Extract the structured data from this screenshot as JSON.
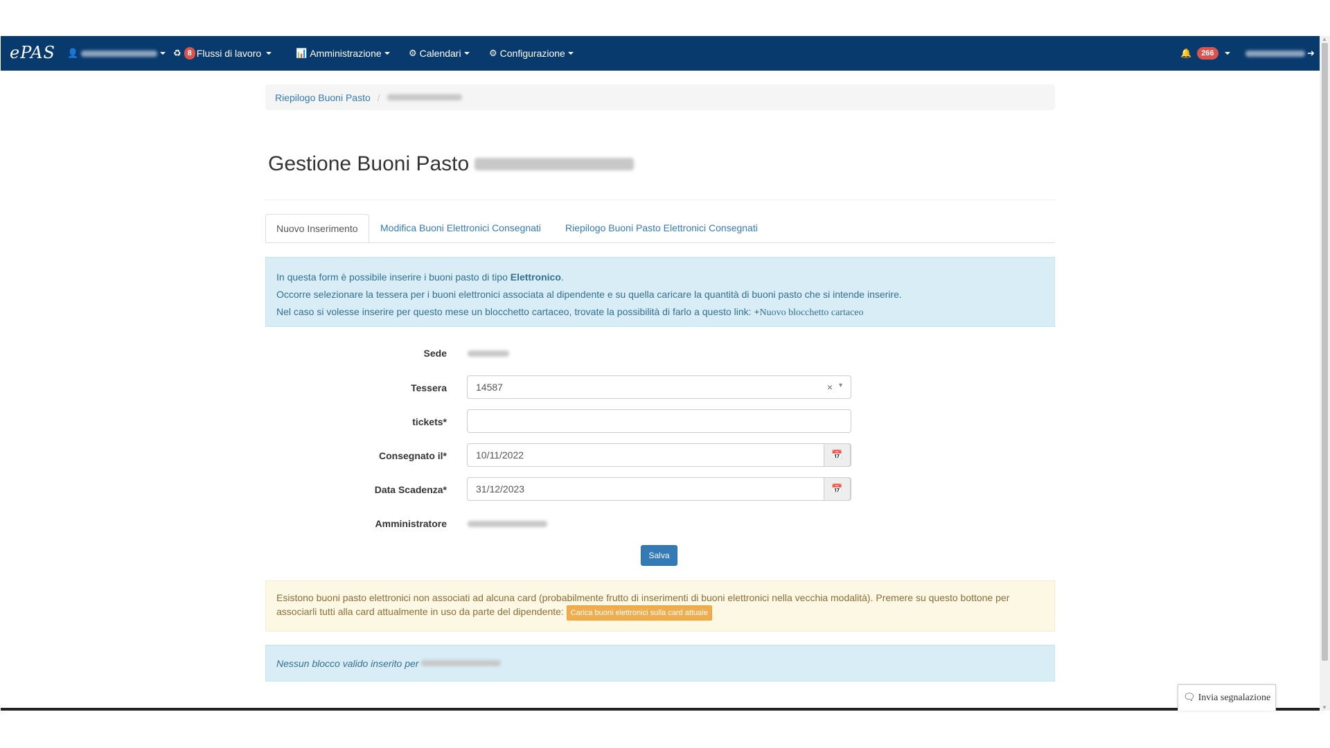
{
  "navbar": {
    "brand": "ePAS",
    "workflows_label": "Flussi di lavoro",
    "workflows_badge": "8",
    "admin_label": "Amministrazione",
    "calendars_label": "Calendari",
    "config_label": "Configurazione",
    "notifications_badge": "266",
    "background_color": "#083a6d"
  },
  "breadcrumb": {
    "item1": "Riepilogo Buoni Pasto",
    "separator": "/"
  },
  "page": {
    "title": "Gestione Buoni Pasto"
  },
  "tabs": {
    "tab1": "Nuovo Inserimento",
    "tab2": "Modifica Buoni Elettronici Consegnati",
    "tab3": "Riepilogo Buoni Pasto Elettronici Consegnati"
  },
  "info": {
    "line1_prefix": "In questa form è possibile inserire i buoni pasto di tipo ",
    "line1_bold": "Elettronico",
    "line1_suffix": ".",
    "line2": "Occorre selezionare la tessera per i buoni elettronici associata al dipendente e su quella caricare la quantità di buoni pasto che si intende inserire.",
    "line3": "Nel caso si volesse inserire per questo mese un blocchetto cartaceo, trovate la possibilità di farlo a questo link: ",
    "link_icon": "+",
    "link_text": "Nuovo blocchetto cartaceo"
  },
  "form": {
    "sede_label": "Sede",
    "tessera_label": "Tessera",
    "tessera_value": "14587",
    "tickets_label": "tickets*",
    "tickets_value": "",
    "consegnato_label": "Consegnato il*",
    "consegnato_value": "10/11/2022",
    "scadenza_label": "Data Scadenza*",
    "scadenza_value": "31/12/2023",
    "amministratore_label": "Amministratore",
    "save_label": "Salva"
  },
  "warning": {
    "text": "Esistono buoni pasto elettronici non associati ad alcuna card (probabilmente frutto di inserimenti di buoni elettronici nella vecchia modalità). Premere su questo bottone per associarli tutti alla card attualmente in uso da parte del dipendente: ",
    "button_label": "Carica buoni elettronici sulla card attuale"
  },
  "info2": {
    "text": "Nessun blocco valido inserito per"
  },
  "feedback": {
    "label": "Invia segnalazione"
  }
}
